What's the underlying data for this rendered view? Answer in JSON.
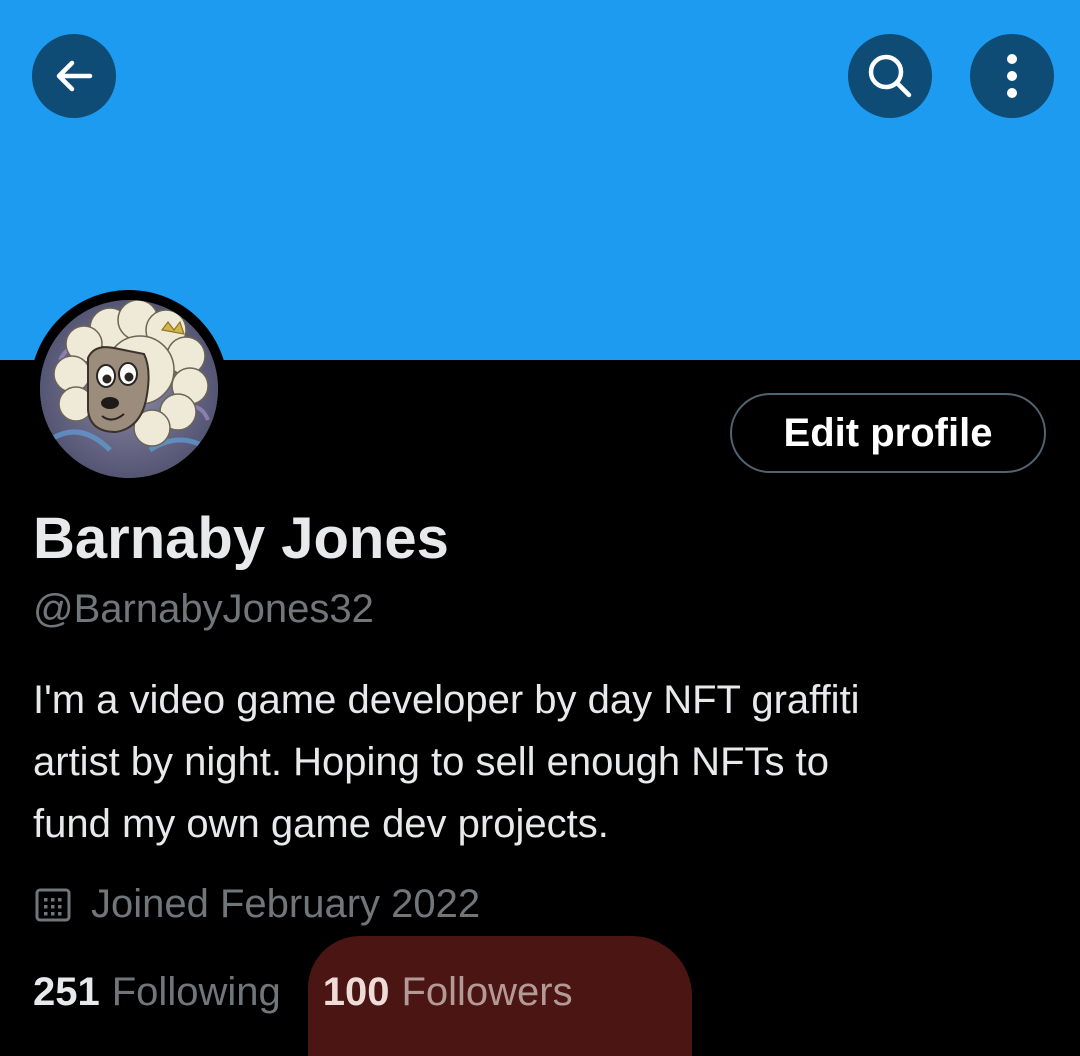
{
  "header": {
    "banner_color": "#1d9bf0",
    "back_icon": "arrow-left-icon",
    "search_icon": "search-icon",
    "more_icon": "more-vertical-icon"
  },
  "profile": {
    "avatar": "sheep-avatar",
    "edit_button_label": "Edit profile",
    "display_name": "Barnaby Jones",
    "handle": "@BarnabyJones32",
    "bio_lines": [
      "I'm a video game developer by day NFT graffiti",
      "artist by night. Hoping to sell enough NFTs to",
      "fund my own game dev projects."
    ],
    "joined": "Joined February 2022",
    "joined_icon": "calendar-icon"
  },
  "stats": {
    "following_count": "251",
    "following_label": "Following",
    "followers_count": "100",
    "followers_label": "Followers"
  },
  "annotation": {
    "highlight_color": "#4a1512"
  }
}
